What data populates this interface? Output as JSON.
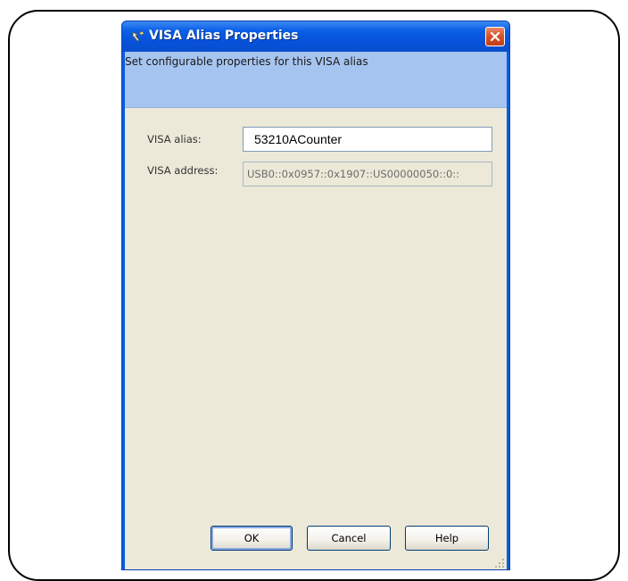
{
  "window": {
    "title": "VISA Alias Properties",
    "icon": "visa-alias-icon",
    "close_icon": "close-icon"
  },
  "banner": {
    "description": "Set configurable properties for this VISA alias"
  },
  "form": {
    "alias_label": "VISA alias:",
    "alias_value": "53210ACounter",
    "address_label": "VISA address:",
    "address_value": "USB0::0x0957::0x1907::US00000050::0::"
  },
  "buttons": {
    "ok": "OK",
    "cancel": "Cancel",
    "help": "Help"
  },
  "colors": {
    "titlebar": "#0a5fe6",
    "banner": "#a6c4f0",
    "client": "#ece9d8",
    "close": "#d8542b"
  }
}
